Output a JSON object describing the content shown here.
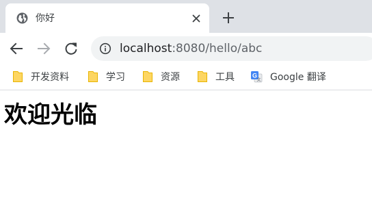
{
  "tab": {
    "title": "你好",
    "favicon": "globe-icon"
  },
  "toolbar": {
    "back_icon": "back-arrow-icon",
    "forward_icon": "forward-arrow-icon",
    "reload_icon": "reload-icon",
    "url_host": "localhost",
    "url_rest": ":8080/hello/abc"
  },
  "bookmarks": [
    {
      "label": "开发资料",
      "icon": "folder-icon"
    },
    {
      "label": "学习",
      "icon": "folder-icon"
    },
    {
      "label": "资源",
      "icon": "folder-icon"
    },
    {
      "label": "工具",
      "icon": "folder-icon"
    },
    {
      "label": "Google 翻译",
      "icon": "google-translate-icon"
    }
  ],
  "page": {
    "heading": "欢迎光临"
  },
  "colors": {
    "tabstrip_bg": "#dee1e6",
    "omnibox_bg": "#f1f3f4",
    "folder_yellow": "#fdd663",
    "translate_blue": "#4285f4"
  }
}
